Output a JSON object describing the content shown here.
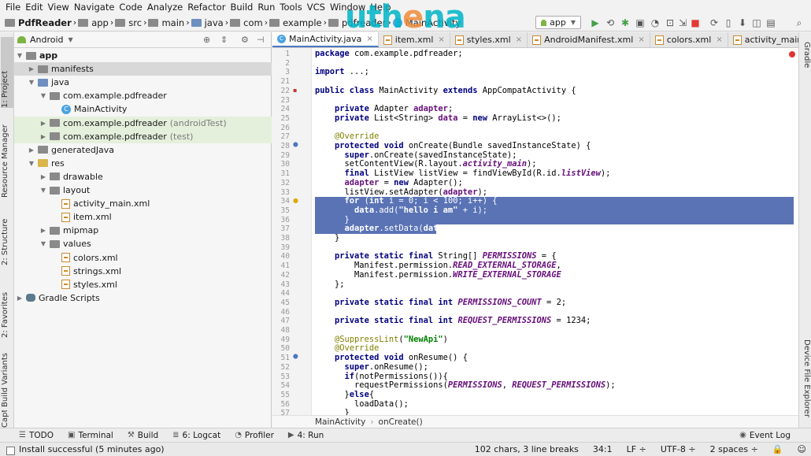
{
  "menu": [
    "File",
    "Edit",
    "View",
    "Navigate",
    "Code",
    "Analyze",
    "Refactor",
    "Build",
    "Run",
    "Tools",
    "VCS",
    "Window",
    "Help"
  ],
  "breadcrumb": [
    "PdfReader",
    "app",
    "src",
    "main",
    "java",
    "com",
    "example",
    "pdfreader",
    "MainActivity"
  ],
  "watermark": [
    "uth",
    "e",
    "na"
  ],
  "run_config": "app",
  "left_tabs": [
    "1: Project",
    "Resource Manager",
    "2: Structure",
    "2: Favorites",
    "Build Variants",
    "Captures"
  ],
  "right_tabs": [
    "Gradle",
    "Device File Explorer"
  ],
  "project": {
    "view": "Android",
    "tree": [
      {
        "label": "app",
        "depth": 0,
        "icon": "folder",
        "expanded": true,
        "bold": true
      },
      {
        "label": "manifests",
        "depth": 1,
        "icon": "folder",
        "expanded": false,
        "selected": true
      },
      {
        "label": "java",
        "depth": 1,
        "icon": "folder",
        "expanded": true
      },
      {
        "label": "com.example.pdfreader",
        "depth": 2,
        "icon": "package",
        "expanded": true
      },
      {
        "label": "MainActivity",
        "depth": 3,
        "icon": "class"
      },
      {
        "label": "com.example.pdfreader",
        "suffix": "(androidTest)",
        "depth": 2,
        "icon": "package",
        "expanded": false,
        "highlight": true
      },
      {
        "label": "com.example.pdfreader",
        "suffix": "(test)",
        "depth": 2,
        "icon": "package",
        "expanded": false,
        "highlight": true
      },
      {
        "label": "generatedJava",
        "depth": 1,
        "icon": "folder",
        "expanded": false
      },
      {
        "label": "res",
        "depth": 1,
        "icon": "folder",
        "expanded": true
      },
      {
        "label": "drawable",
        "depth": 2,
        "icon": "folder",
        "expanded": false
      },
      {
        "label": "layout",
        "depth": 2,
        "icon": "folder",
        "expanded": true
      },
      {
        "label": "activity_main.xml",
        "depth": 3,
        "icon": "xml"
      },
      {
        "label": "item.xml",
        "depth": 3,
        "icon": "xml"
      },
      {
        "label": "mipmap",
        "depth": 2,
        "icon": "folder",
        "expanded": false
      },
      {
        "label": "values",
        "depth": 2,
        "icon": "folder",
        "expanded": true
      },
      {
        "label": "colors.xml",
        "depth": 3,
        "icon": "xml"
      },
      {
        "label": "strings.xml",
        "depth": 3,
        "icon": "xml"
      },
      {
        "label": "styles.xml",
        "depth": 3,
        "icon": "xml"
      },
      {
        "label": "Gradle Scripts",
        "depth": 0,
        "icon": "gradle",
        "expanded": false
      }
    ]
  },
  "editor_tabs": [
    {
      "label": "MainActivity.java",
      "icon": "class",
      "active": true
    },
    {
      "label": "item.xml",
      "icon": "xml"
    },
    {
      "label": "styles.xml",
      "icon": "xml"
    },
    {
      "label": "AndroidManifest.xml",
      "icon": "xml"
    },
    {
      "label": "colors.xml",
      "icon": "xml"
    },
    {
      "label": "activity_main.xml",
      "icon": "xml"
    }
  ],
  "code_lines": [
    {
      "n": "1",
      "html": "<span class='kw'>package</span> com.example.pdfreader;"
    },
    {
      "n": "2",
      "html": ""
    },
    {
      "n": "3",
      "html": "<span class='kw'>import</span> ...;"
    },
    {
      "n": "21",
      "html": ""
    },
    {
      "n": "22",
      "html": "<span class='kw'>public class</span> MainActivity <span class='kw'>extends</span> AppCompatActivity {"
    },
    {
      "n": "23",
      "html": ""
    },
    {
      "n": "24",
      "html": "    <span class='kw'>private</span> Adapter <span class='fld'>adapter</span>;"
    },
    {
      "n": "25",
      "html": "    <span class='kw'>private</span> List&lt;String&gt; <span class='fld'>data</span> = <span class='kw'>new</span> ArrayList&lt;&gt;();"
    },
    {
      "n": "26",
      "html": ""
    },
    {
      "n": "27",
      "html": "    <span class='ann'>@Override</span>"
    },
    {
      "n": "28",
      "html": "    <span class='kw'>protected void</span> onCreate(Bundle savedInstanceState) {"
    },
    {
      "n": "29",
      "html": "      <span class='kw'>super</span>.onCreate(savedInstanceState);"
    },
    {
      "n": "30",
      "html": "      setContentView(R.layout.<span class='fldi'>activity_main</span>);"
    },
    {
      "n": "31",
      "html": "      <span class='kw'>final</span> ListView listView = findViewById(R.id.<span class='fldi'>listView</span>);"
    },
    {
      "n": "32",
      "html": "      <span class='fld'>adapter</span> = <span class='kw'>new</span> Adapter();"
    },
    {
      "n": "33",
      "html": "      listView.setAdapter(<span class='fld'>adapter</span>);"
    },
    {
      "n": "34",
      "html": "      <span class='kw'>for</span> (<span class='kw'>int</span> i = 0; i &lt; 100; i++) {",
      "sel": true
    },
    {
      "n": "35",
      "html": "        <span class='fld'>data</span>.add(<span class='str'>\"hello i am\"</span> + i);",
      "sel": true
    },
    {
      "n": "36",
      "html": "      }",
      "sel": true
    },
    {
      "n": "37",
      "html": "      <span class='fld'>adapter</span>.setData(<span class='fld'>data</span>);",
      "sel": true,
      "partial": true
    },
    {
      "n": "38",
      "html": "    }"
    },
    {
      "n": "39",
      "html": ""
    },
    {
      "n": "40",
      "html": "    <span class='kw'>private static final</span> String[] <span class='fldi'>PERMISSIONS</span> = {"
    },
    {
      "n": "41",
      "html": "        Manifest.permission.<span class='fldi'>READ_EXTERNAL_STORAGE</span>,"
    },
    {
      "n": "42",
      "html": "        Manifest.permission.<span class='fldi'>WRITE_EXTERNAL_STORAGE</span>"
    },
    {
      "n": "43",
      "html": "    };"
    },
    {
      "n": "44",
      "html": ""
    },
    {
      "n": "45",
      "html": "    <span class='kw'>private static final int</span> <span class='fldi'>PERMISSIONS_COUNT</span> = 2;"
    },
    {
      "n": "46",
      "html": ""
    },
    {
      "n": "47",
      "html": "    <span class='kw'>private static final int</span> <span class='fldi'>REQUEST_PERMISSIONS</span> = 1234;"
    },
    {
      "n": "48",
      "html": ""
    },
    {
      "n": "49",
      "html": "    <span class='ann'>@SuppressLint</span>(<span class='str'>\"NewApi\"</span>)"
    },
    {
      "n": "50",
      "html": "    <span class='ann'>@Override</span>"
    },
    {
      "n": "51",
      "html": "    <span class='kw'>protected void</span> onResume() {"
    },
    {
      "n": "52",
      "html": "      <span class='kw'>super</span>.onResume();"
    },
    {
      "n": "53",
      "html": "      <span class='kw'>if</span>(notPermissions()){"
    },
    {
      "n": "54",
      "html": "        requestPermissions(<span class='fldi'>PERMISSIONS</span>, <span class='fldi'>REQUEST_PERMISSIONS</span>);"
    },
    {
      "n": "55",
      "html": "      }<span class='kw'>else</span>{"
    },
    {
      "n": "56",
      "html": "        loadData();"
    },
    {
      "n": "57",
      "html": "      }"
    }
  ],
  "editor_breadcrumb": [
    "MainActivity",
    "onCreate()"
  ],
  "bottom_tools": [
    {
      "label": "TODO",
      "icon": "list-icon"
    },
    {
      "label": "Terminal",
      "icon": "terminal-icon"
    },
    {
      "label": "Build",
      "icon": "hammer-icon"
    },
    {
      "label": "6: Logcat",
      "icon": "logcat-icon"
    },
    {
      "label": "Profiler",
      "icon": "profiler-icon"
    },
    {
      "label": "4: Run",
      "icon": "run-icon"
    }
  ],
  "event_log": "Event Log",
  "status": {
    "message": "Install successful (5 minutes ago)",
    "selection": "102 chars, 3 line breaks",
    "position": "34:1",
    "line_sep": "LF",
    "encoding": "UTF-8",
    "indent": "2 spaces"
  }
}
